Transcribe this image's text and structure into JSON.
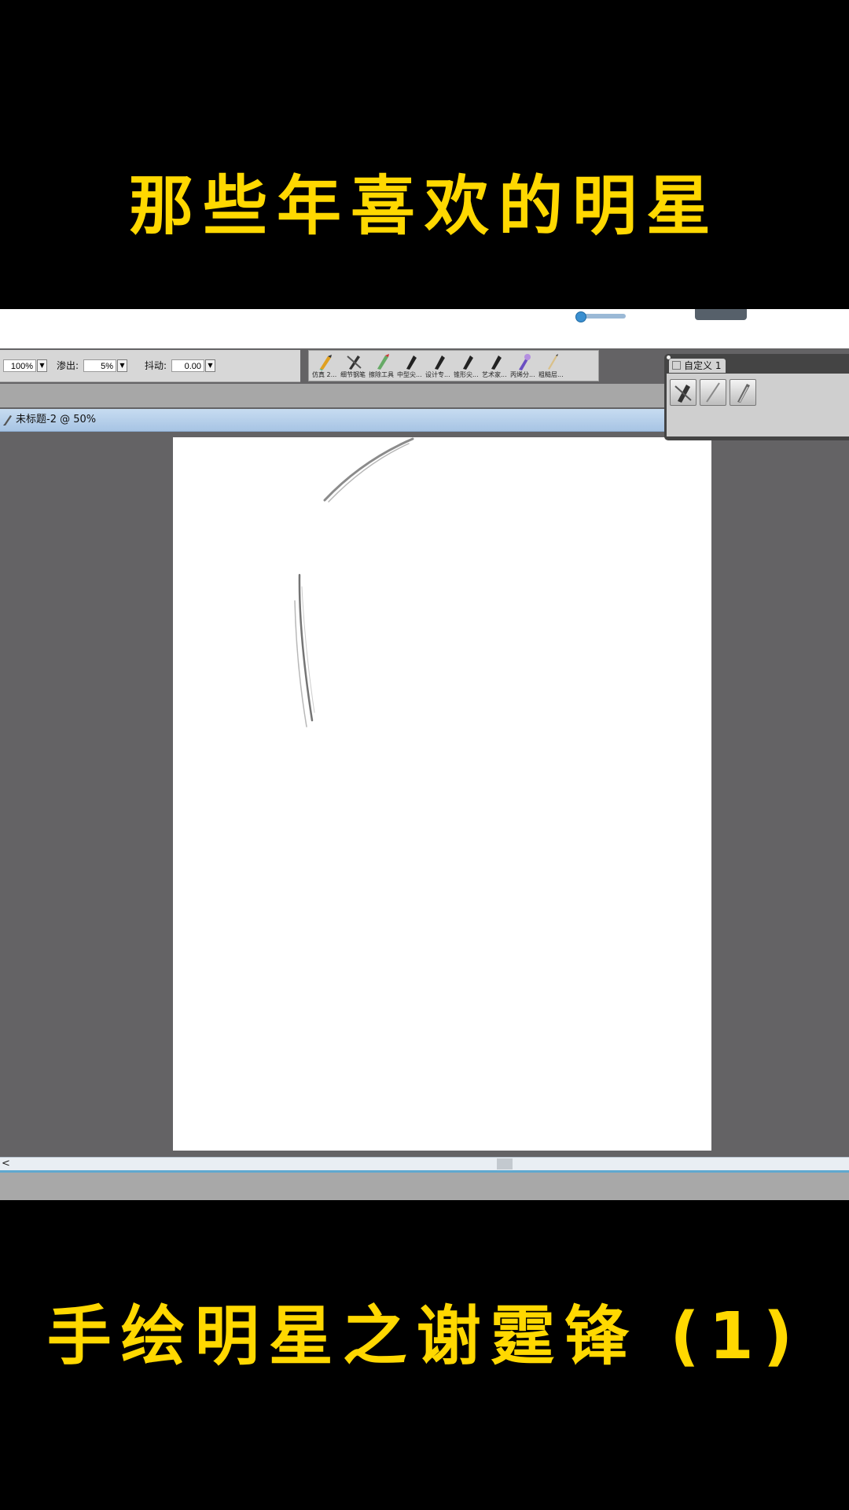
{
  "overlay": {
    "top_caption": "那些年喜欢的明星",
    "bottom_caption": "手绘明星之谢霆锋 (1)"
  },
  "property_bar": {
    "opacity_value": "100%",
    "bleed_label": "渗出:",
    "bleed_value": "5%",
    "jitter_label": "抖动:",
    "jitter_value": "0.00"
  },
  "brush_library": {
    "brushes": [
      {
        "label": "仿真 2...",
        "icon": "colored-pencil-icon"
      },
      {
        "label": "细节钢笔",
        "icon": "pen-icon"
      },
      {
        "label": "擦除工具",
        "icon": "eraser-icon"
      },
      {
        "label": "中型尖...",
        "icon": "nib-icon"
      },
      {
        "label": "设计专...",
        "icon": "nib-icon"
      },
      {
        "label": "锥形尖...",
        "icon": "nib-icon"
      },
      {
        "label": "艺术家...",
        "icon": "nib-icon"
      },
      {
        "label": "丙烯分...",
        "icon": "acrylic-brush-icon"
      },
      {
        "label": "粗糙层...",
        "icon": "pencil-icon"
      }
    ]
  },
  "document": {
    "title": "未标题-2 @ 50%"
  },
  "custom_panel": {
    "tab_label": "自定义 1",
    "buttons": [
      "nib-icon",
      "pencil-line-icon",
      "brush-icon"
    ]
  },
  "scrollbar": {
    "left_arrow": "<"
  },
  "colors": {
    "caption": "#ffd800",
    "workspace": "#646365",
    "title_bar": "#a7c4e4"
  }
}
